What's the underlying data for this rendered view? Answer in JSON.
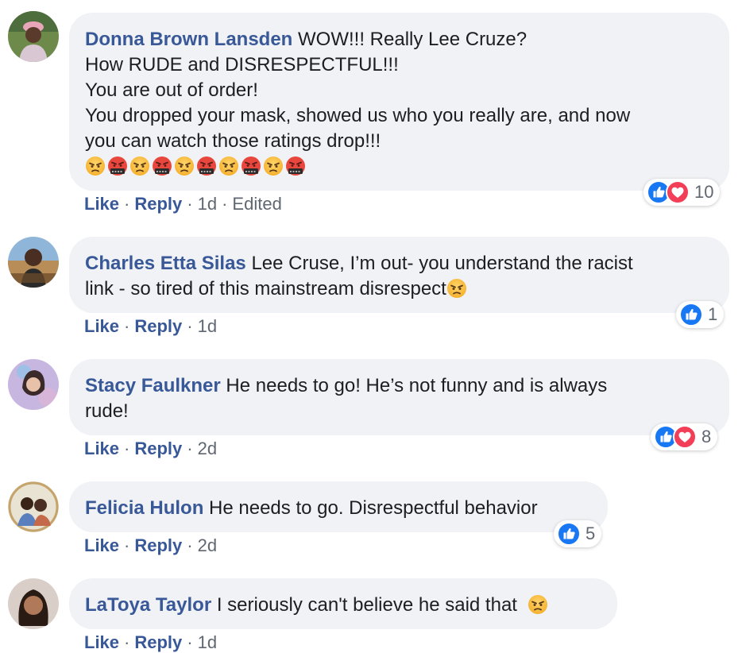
{
  "comments": [
    {
      "author": "Donna Brown Lansden",
      "lines": [
        "WOW!!! Really Lee Cruze?",
        "How RUDE and DISRESPECTFUL!!!",
        "You are out of order!",
        "You dropped your mask, showed us who you really are, and now",
        "you can watch those ratings drop!!!"
      ],
      "emojis": [
        "angry-face-icon",
        "swearing-face-icon",
        "angry-face-icon",
        "swearing-face-icon",
        "angry-face-icon",
        "swearing-face-icon",
        "angry-face-icon",
        "swearing-face-icon",
        "angry-face-icon",
        "swearing-face-icon"
      ],
      "like": "Like",
      "reply": "Reply",
      "time": "1d",
      "edited": "Edited",
      "reaction_count": "10"
    },
    {
      "author": "Charles Etta Silas",
      "lines": [
        "Lee Cruse, I’m out- you understand the racist",
        "link - so tired of this mainstream disrespect"
      ],
      "like": "Like",
      "reply": "Reply",
      "time": "1d",
      "reaction_count": "1"
    },
    {
      "author": "Stacy Faulkner",
      "lines": [
        "He needs to go! He’s not funny and is always",
        "rude!"
      ],
      "like": "Like",
      "reply": "Reply",
      "time": "2d",
      "reaction_count": "8"
    },
    {
      "author": "Felicia Hulon",
      "lines": [
        "He needs to go. Disrespectful behavior"
      ],
      "like": "Like",
      "reply": "Reply",
      "time": "2d",
      "reaction_count": "5"
    },
    {
      "author": "LaToya Taylor",
      "lines": [
        "I seriously can't believe he said that"
      ],
      "like": "Like",
      "reply": "Reply",
      "time": "1d"
    }
  ],
  "colors": {
    "link": "#385898",
    "bubble": "#f0f2f5",
    "meta": "#606770",
    "like_blue": "#1877f2",
    "love_red": "#f33e58"
  }
}
